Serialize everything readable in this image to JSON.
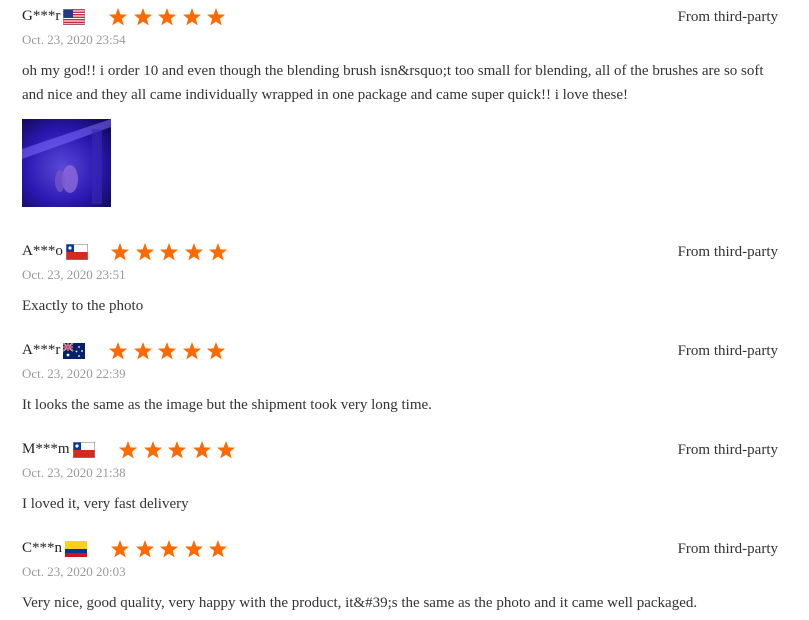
{
  "reviews": [
    {
      "user": "G***r",
      "country_flag": "us-flag-icon",
      "stars": 5,
      "source": "From third-party",
      "date": "Oct. 23, 2020 23:54",
      "text": "oh my god!! i order 10 and even though the blending brush isn&rsquo;t too small for blending, all of the brushes are so soft and nice and they all came individually wrapped in one package and came super quick!! i love these!",
      "has_photo": true
    },
    {
      "user": "A***o",
      "country_flag": "chile-flag-icon",
      "stars": 5,
      "source": "From third-party",
      "date": "Oct. 23, 2020 23:51",
      "text": "Exactly to the photo"
    },
    {
      "user": "A***r",
      "country_flag": "australia-flag-icon",
      "stars": 5,
      "source": "From third-party",
      "date": "Oct. 23, 2020 22:39",
      "text": "It looks the same as the image but the shipment took very long time."
    },
    {
      "user": "M***m",
      "country_flag": "chile-flag-icon",
      "stars": 5,
      "source": "From third-party",
      "date": "Oct. 23, 2020 21:38",
      "text": "I loved it, very fast delivery"
    },
    {
      "user": "C***n",
      "country_flag": "colombia-flag-icon",
      "stars": 5,
      "source": "From third-party",
      "date": "Oct. 23, 2020 20:03",
      "text": "Very nice, good quality, very happy with the product, it&#39;s the same as the photo and it came well packaged."
    }
  ],
  "colors": {
    "star": "#ff6a00",
    "date": "#9a9a9a",
    "text": "#333333"
  }
}
